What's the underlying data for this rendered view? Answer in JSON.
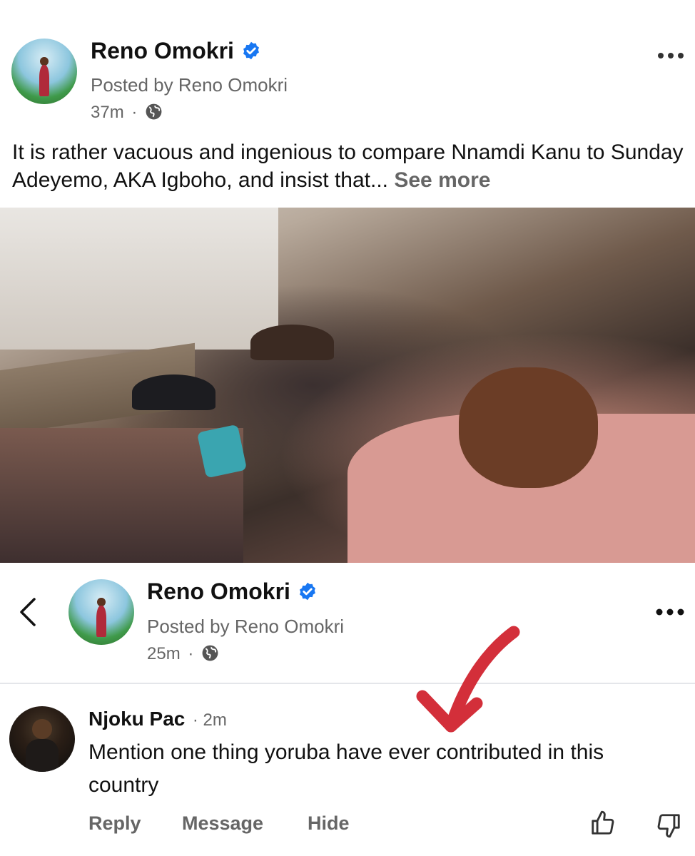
{
  "post": {
    "author": "Reno Omokri",
    "posted_by": "Posted by Reno Omokri",
    "time": "37m",
    "separator": "·",
    "more_icon": "more-horizontal-icon",
    "text": "It is rather vacuous and ingenious to compare Nnamdi Kanu to Sunday Adeyemo, AKA Igboho, and insist that...",
    "see_more": "See more"
  },
  "header2": {
    "author": "Reno Omokri",
    "posted_by": "Posted by Reno Omokri",
    "time": "25m",
    "separator": "·"
  },
  "comment": {
    "author": "Njoku Pac",
    "time": "· 2m",
    "text": "Mention one thing yoruba have ever contributed in this country",
    "actions": {
      "reply": "Reply",
      "message": "Message",
      "hide": "Hide"
    }
  },
  "colors": {
    "verified": "#1877f2",
    "annotation_arrow": "#d32f3a",
    "secondary_text": "#666666"
  }
}
